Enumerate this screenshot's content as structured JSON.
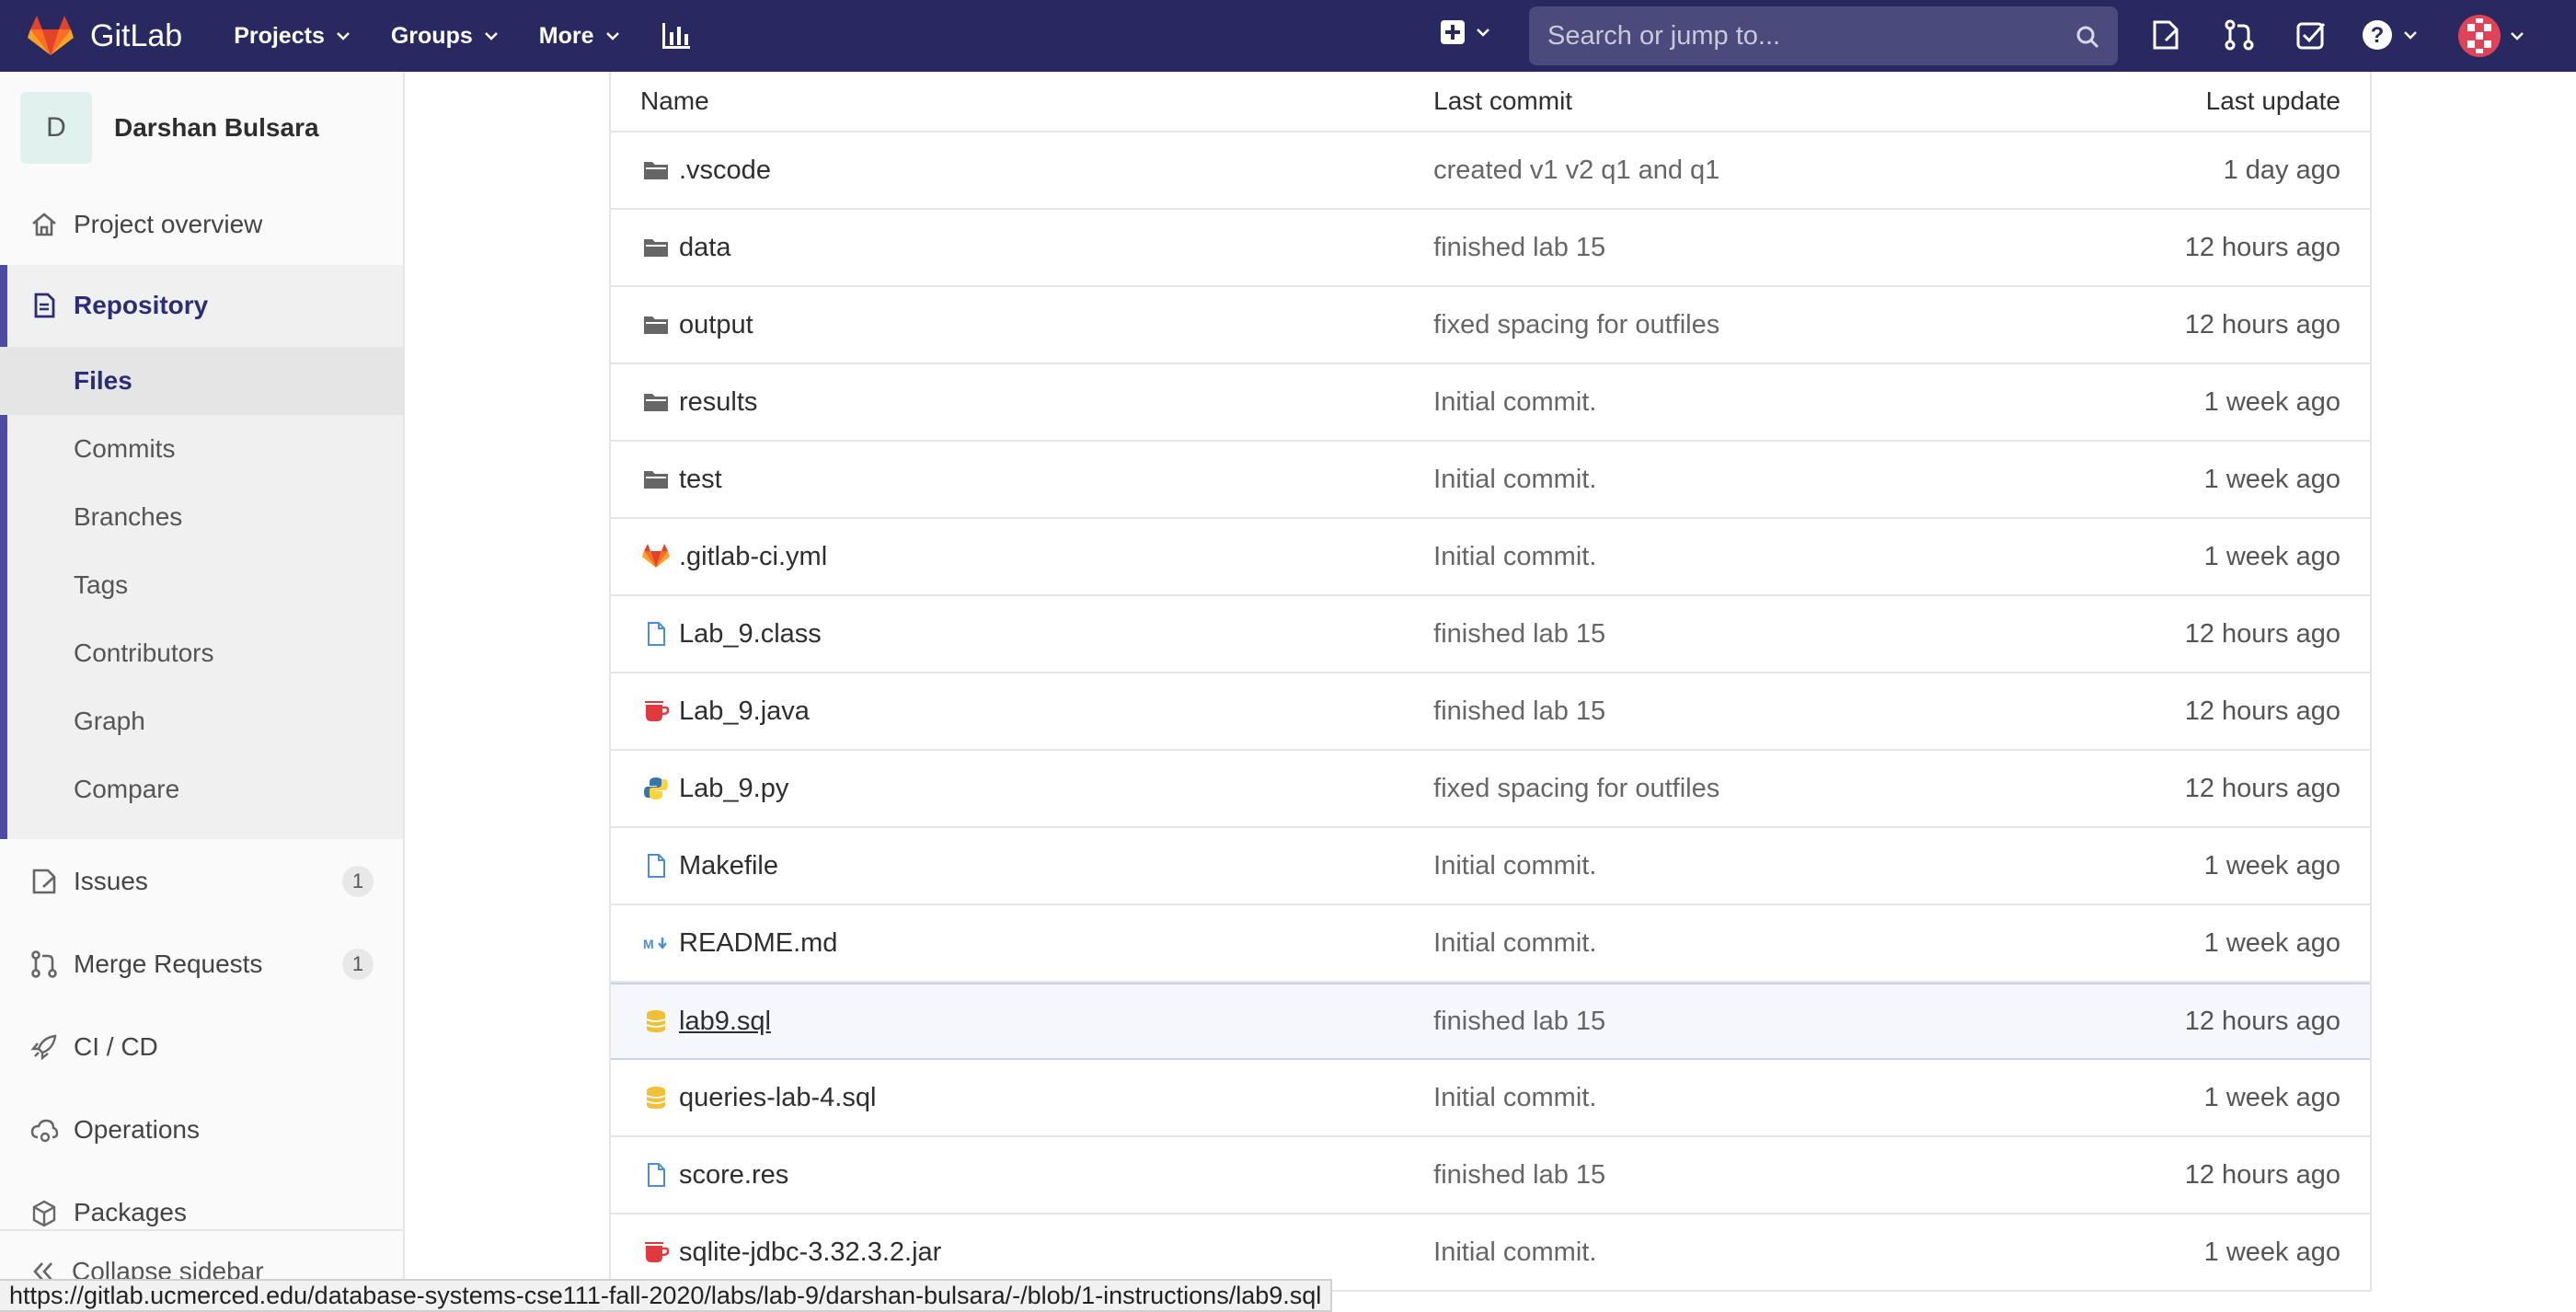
{
  "navbar": {
    "brand": "GitLab",
    "menu": [
      {
        "label": "Projects"
      },
      {
        "label": "Groups"
      },
      {
        "label": "More"
      }
    ],
    "search_placeholder": "Search or jump to...",
    "colors": {
      "bg": "#292961",
      "search_bg": "#4a4a7d"
    }
  },
  "sidebar": {
    "project_initial": "D",
    "project_name": "Darshan Bulsara",
    "items": [
      {
        "label": "Project overview",
        "icon": "home-icon"
      },
      {
        "label": "Repository",
        "icon": "repository-icon"
      },
      {
        "label": "Issues",
        "icon": "issues-icon",
        "badge": "1"
      },
      {
        "label": "Merge Requests",
        "icon": "merge-request-icon",
        "badge": "1"
      },
      {
        "label": "CI / CD",
        "icon": "rocket-icon"
      },
      {
        "label": "Operations",
        "icon": "cloud-gear-icon"
      },
      {
        "label": "Packages",
        "icon": "package-icon"
      }
    ],
    "repo_sub": [
      "Files",
      "Commits",
      "Branches",
      "Tags",
      "Contributors",
      "Graph",
      "Compare"
    ],
    "collapse_label": "Collapse sidebar"
  },
  "table": {
    "headers": {
      "name": "Name",
      "commit": "Last commit",
      "update": "Last update"
    },
    "rows": [
      {
        "name": ".vscode",
        "type": "folder",
        "commit": "created v1 v2 q1 and q1",
        "update": "1 day ago"
      },
      {
        "name": "data",
        "type": "folder",
        "commit": "finished lab 15",
        "update": "12 hours ago"
      },
      {
        "name": "output",
        "type": "folder",
        "commit": "fixed spacing for outfiles",
        "update": "12 hours ago"
      },
      {
        "name": "results",
        "type": "folder",
        "commit": "Initial commit.",
        "update": "1 week ago"
      },
      {
        "name": "test",
        "type": "folder",
        "commit": "Initial commit.",
        "update": "1 week ago"
      },
      {
        "name": ".gitlab-ci.yml",
        "type": "gitlab",
        "commit": "Initial commit.",
        "update": "1 week ago"
      },
      {
        "name": "Lab_9.class",
        "type": "file",
        "commit": "finished lab 15",
        "update": "12 hours ago"
      },
      {
        "name": "Lab_9.java",
        "type": "java",
        "commit": "finished lab 15",
        "update": "12 hours ago"
      },
      {
        "name": "Lab_9.py",
        "type": "python",
        "commit": "fixed spacing for outfiles",
        "update": "12 hours ago"
      },
      {
        "name": "Makefile",
        "type": "file",
        "commit": "Initial commit.",
        "update": "1 week ago"
      },
      {
        "name": "README.md",
        "type": "markdown",
        "commit": "Initial commit.",
        "update": "1 week ago"
      },
      {
        "name": "lab9.sql",
        "type": "database",
        "commit": "finished lab 15",
        "update": "12 hours ago"
      },
      {
        "name": "queries-lab-4.sql",
        "type": "database",
        "commit": "Initial commit.",
        "update": "1 week ago"
      },
      {
        "name": "score.res",
        "type": "file",
        "commit": "finished lab 15",
        "update": "12 hours ago"
      },
      {
        "name": "sqlite-jdbc-3.32.3.2.jar",
        "type": "java",
        "commit": "Initial commit.",
        "update": "1 week ago"
      }
    ]
  },
  "statusbar": {
    "url": "https://gitlab.ucmerced.edu/database-systems-cse111-fall-2020/labs/lab-9/darshan-bulsara/-/blob/1-instructions/lab9.sql"
  }
}
